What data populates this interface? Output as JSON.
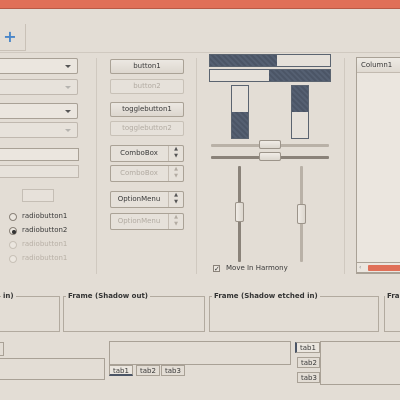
{
  "window": {
    "accent_color": "#e07058"
  },
  "toolbar": {
    "add_icon": "plus-icon"
  },
  "buttons": {
    "button1": "button1",
    "button2": "button2",
    "togglebutton1": "togglebutton1",
    "togglebutton2": "togglebutton2"
  },
  "dropdowns": {
    "combobox1": "ComboBox",
    "combobox2": "ComboBox",
    "optionmenu1": "OptionMenu",
    "optionmenu2": "OptionMenu"
  },
  "radios": [
    {
      "label": "radiobutton1",
      "checked": false,
      "enabled": true
    },
    {
      "label": "radiobutton2",
      "checked": true,
      "enabled": true
    },
    {
      "label": "radiobutton1",
      "checked": false,
      "enabled": false
    },
    {
      "label": "radiobutton1",
      "checked": false,
      "enabled": false
    }
  ],
  "progress": {
    "h1": 0.56,
    "h2": 0.51,
    "v1": 0.5,
    "v2": 0.5
  },
  "checkbox": {
    "label": "Move In Harmony",
    "checked": true
  },
  "tree": {
    "column1": "Column1"
  },
  "frames": {
    "frame_in": "Frame (Shadow in)",
    "frame_in_visible": "in)",
    "frame_out": "Frame (Shadow out)",
    "frame_etched_in": "Frame (Shadow etched in)",
    "frame_etched_out_visible": "Fra"
  },
  "tabs_bottom": [
    "tab1",
    "tab2",
    "tab3"
  ],
  "tabs_left": [
    "tab1",
    "tab2",
    "tab3"
  ]
}
